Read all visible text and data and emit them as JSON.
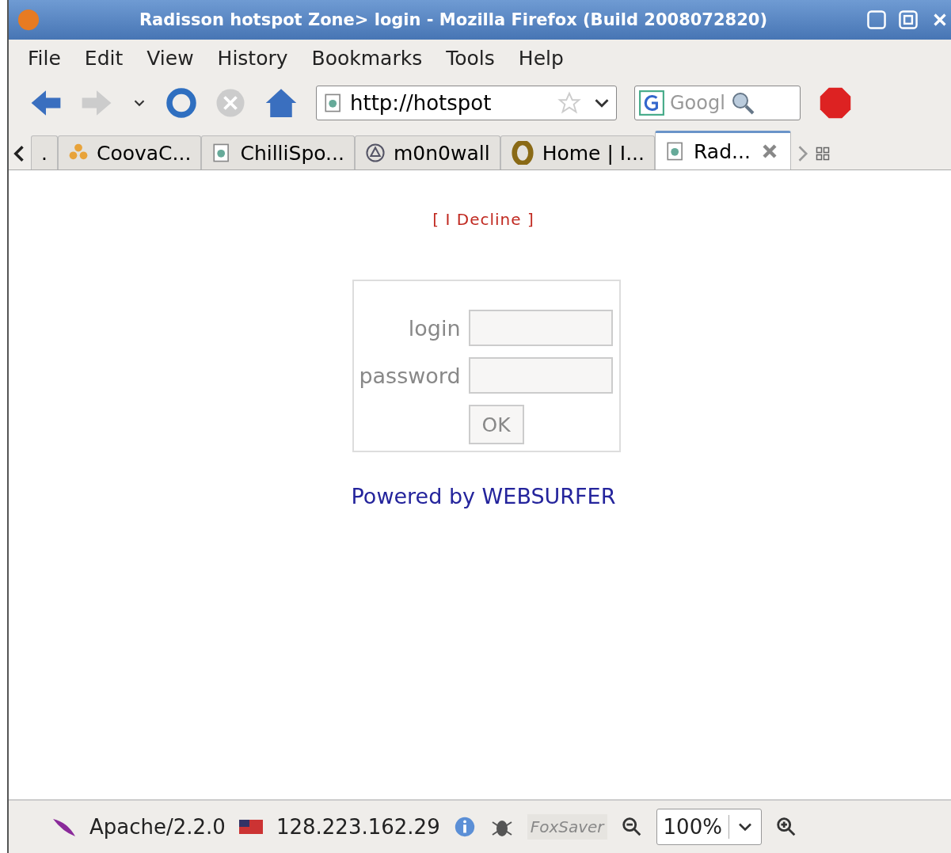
{
  "window": {
    "title": "Radisson hotspot Zone> login - Mozilla Firefox (Build 2008072820)"
  },
  "menu": [
    "File",
    "Edit",
    "View",
    "History",
    "Bookmarks",
    "Tools",
    "Help"
  ],
  "address": {
    "value": "http://hotspot"
  },
  "search": {
    "placeholder": "Googl"
  },
  "tabs": [
    {
      "label": ".",
      "selected": false,
      "kind": "plain"
    },
    {
      "label": "CoovaC...",
      "selected": false,
      "kind": "flower"
    },
    {
      "label": "ChilliSpo...",
      "selected": false,
      "kind": "page"
    },
    {
      "label": "m0n0wall",
      "selected": false,
      "kind": "circle"
    },
    {
      "label": "Home | I...",
      "selected": false,
      "kind": "ring"
    },
    {
      "label": "Rad...",
      "selected": true,
      "kind": "page"
    }
  ],
  "page": {
    "decline_link": "[ I Decline ]",
    "fields": [
      {
        "label": "login"
      },
      {
        "label": "password"
      }
    ],
    "submit": "OK",
    "footer_link": "Powered by WEBSURFER"
  },
  "status_bar": {
    "server": "Apache/2.2.0",
    "ip": "128.223.162.29",
    "foxsaver": "FoxSaver",
    "zoom": "100%"
  }
}
